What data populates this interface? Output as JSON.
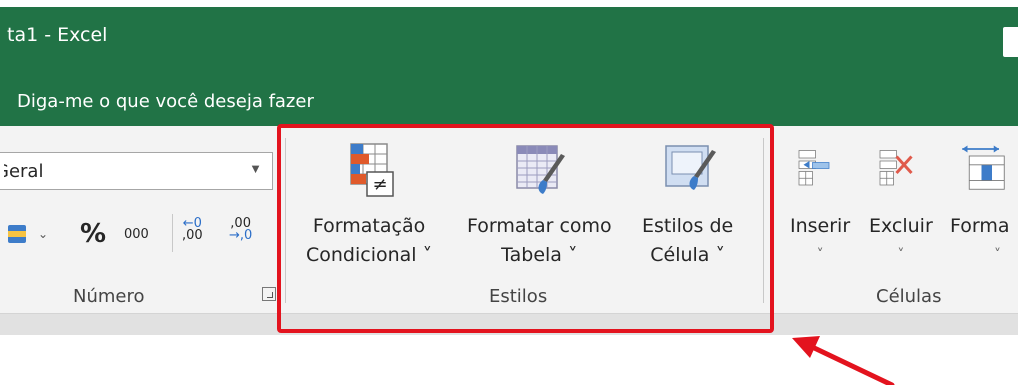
{
  "window": {
    "title": "ta1  -  Excel"
  },
  "tell_me": {
    "text": "Diga-me o que você deseja fazer"
  },
  "number_group": {
    "format_value": "Geral",
    "percent_label": "%",
    "thousands_label": "000",
    "increase_decimal_top": "←0",
    "increase_decimal_bottom": ",00",
    "decrease_decimal_top": ",00",
    "decrease_decimal_bottom": "→,0",
    "group_label": "Número"
  },
  "styles_group": {
    "conditional_formatting": {
      "line1": "Formatação",
      "line2": "Condicional ˅"
    },
    "format_as_table": {
      "line1": "Formatar como",
      "line2": "Tabela ˅"
    },
    "cell_styles": {
      "line1": "Estilos de",
      "line2": "Célula ˅"
    },
    "group_label": "Estilos"
  },
  "cells_group": {
    "insert": {
      "label": "Inserir",
      "chevron": "˅"
    },
    "delete": {
      "label": "Excluir",
      "chevron": "˅"
    },
    "format": {
      "label": "Forma",
      "chevron": "˅"
    },
    "group_label": "Células"
  },
  "colors": {
    "title_bar": "#217346",
    "highlight": "#e3131e",
    "ribbon": "#f3f3f3"
  }
}
